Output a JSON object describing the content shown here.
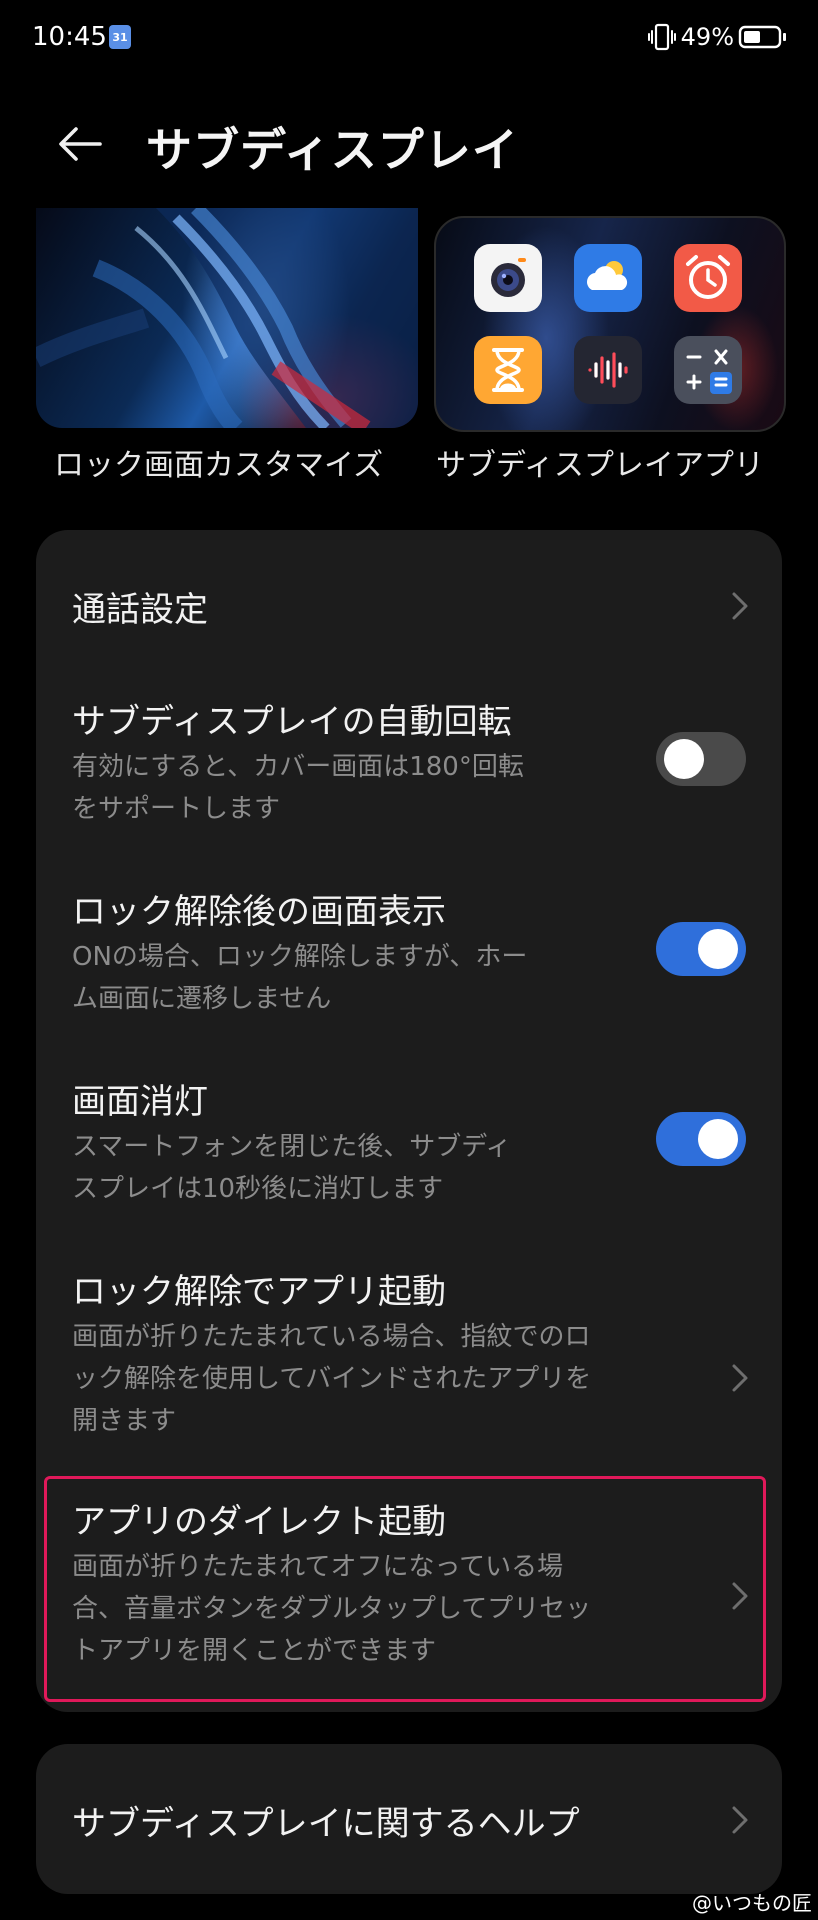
{
  "status_bar": {
    "time": "10:45",
    "calendar_badge": "31",
    "battery_percent": "49%",
    "battery_level": 0.49
  },
  "header": {
    "title": "サブディスプレイ"
  },
  "previews": {
    "lock_caption": "ロック画面カスタマイズ",
    "apps_caption": "サブディスプレイアプリ",
    "app_icons": [
      "camera-app-icon",
      "weather-app-icon",
      "alarm-app-icon",
      "timer-app-icon",
      "recorder-app-icon",
      "calculator-app-icon"
    ]
  },
  "settings": {
    "call": {
      "title": "通話設定"
    },
    "auto_rotate": {
      "title": "サブディスプレイの自動回転",
      "desc_line1": "有効にすると、カバー画面は180°回転",
      "desc_line2": "をサポートします",
      "enabled": false
    },
    "after_unlock": {
      "title": "ロック解除後の画面表示",
      "desc_line1": "ONの場合、ロック解除しますが、ホー",
      "desc_line2": "ム画面に遷移しません",
      "enabled": true
    },
    "screen_off": {
      "title": "画面消灯",
      "desc_line1": "スマートフォンを閉じた後、サブディ",
      "desc_line2": "スプレイは10秒後に消灯します",
      "enabled": true
    },
    "unlock_launch": {
      "title": "ロック解除でアプリ起動",
      "desc_line1": "画面が折りたたまれている場合、指紋でのロ",
      "desc_line2": "ック解除を使用してバインドされたアプリを",
      "desc_line3": "開きます"
    },
    "direct_launch": {
      "title": "アプリのダイレクト起動",
      "desc_line1": "画面が折りたたまれてオフになっている場",
      "desc_line2": "合、音量ボタンをダブルタップしてプリセッ",
      "desc_line3": "トアプリを開くことができます"
    },
    "help": {
      "title": "サブディスプレイに関するヘルプ"
    }
  },
  "colors": {
    "accent": "#2f6fdb",
    "highlight_border": "#e0195a",
    "card_bg": "#1c1c1c"
  },
  "watermark": "@いつもの匠"
}
